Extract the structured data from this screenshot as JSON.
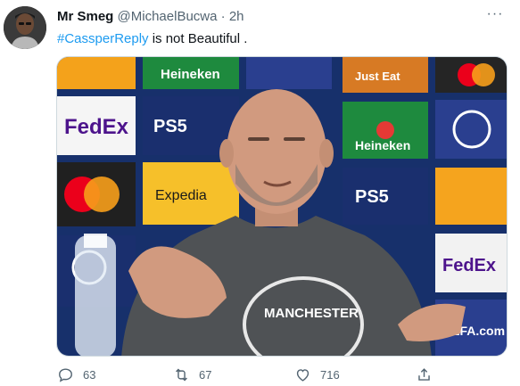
{
  "tweet": {
    "display_name": "Mr Smeg",
    "handle": "@MichaelBucwa",
    "separator": "·",
    "time": "2h",
    "more_label": "···",
    "hashtag": "#CassperReply",
    "text": " is not Beautiful .",
    "media": {
      "backdrop_sponsors": [
        "Heineken",
        "FedEx",
        "PS5",
        "Expedia",
        "Just Eat",
        "UEFA.com"
      ],
      "shirt_text": "MANCHESTER"
    }
  },
  "actions": {
    "reply_count": "63",
    "retweet_count": "67",
    "like_count": "716"
  },
  "colors": {
    "accent": "#1d9bf0",
    "secondary_text": "#536471"
  }
}
